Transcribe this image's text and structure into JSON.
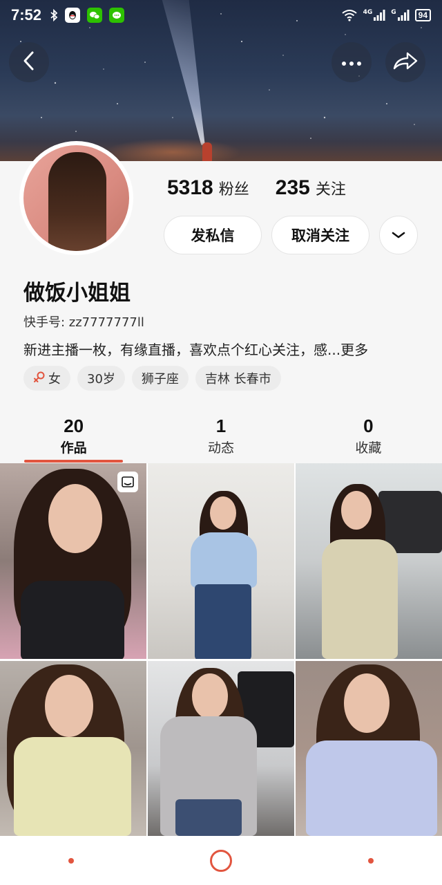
{
  "status_bar": {
    "time": "7:52",
    "signal_1": "4G",
    "signal_2": "G",
    "battery": "94"
  },
  "header": {
    "back_icon": "chevron-left-icon",
    "more_icon": "ellipsis-icon",
    "share_icon": "share-arrow-icon"
  },
  "profile": {
    "followers_count": "5318",
    "followers_label": "粉丝",
    "following_count": "235",
    "following_label": "关注",
    "message_button": "发私信",
    "unfollow_button": "取消关注",
    "name": "做饭小姐姐",
    "kuaishou_id": "快手号: zz7777777ll",
    "bio": "新进主播一枚，有缘直播，喜欢点个红心关注，感...更多",
    "tags": [
      "女",
      "30岁",
      "狮子座",
      "吉林 长春市"
    ]
  },
  "tabs": [
    {
      "count": "20",
      "label": "作品"
    },
    {
      "count": "1",
      "label": "动态"
    },
    {
      "count": "0",
      "label": "收藏"
    }
  ],
  "colors": {
    "accent": "#e2553f",
    "profile_bg": "#f6f6f6"
  }
}
